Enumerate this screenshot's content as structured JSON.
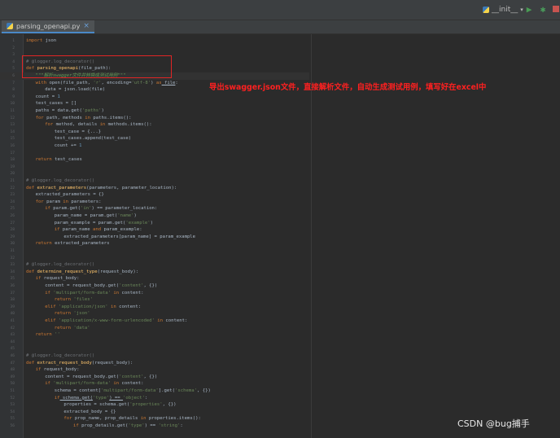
{
  "toolbar": {
    "run_config_label": "__init__",
    "icons": [
      "python-file-icon",
      "chevron-down-icon",
      "run-icon",
      "debug-icon",
      "stop-icon"
    ],
    "colors": {
      "run": "#499c54",
      "debug": "#4a9e5c",
      "stop": "#c75450"
    }
  },
  "tab": {
    "file_name": "parsing_openapi.py",
    "close_glyph": "×"
  },
  "annotation": "导出swagger.json文件，直接解析文件，自动生成测试用例，填写好在excel中",
  "watermark": "CSDN @bug捕手",
  "colors": {
    "annotation": "#ff2020",
    "highlight_box": "#e02525",
    "editor_bg": "#2b2b2b"
  },
  "code_lines": [
    {
      "n": "1",
      "indent": 0,
      "parts": [
        {
          "t": "kw",
          "v": "import"
        },
        {
          "t": "",
          "v": " json"
        }
      ]
    },
    {
      "n": "2",
      "indent": 0,
      "parts": []
    },
    {
      "n": "3",
      "indent": 0,
      "parts": []
    },
    {
      "n": "4",
      "indent": 0,
      "parts": [
        {
          "t": "dec",
          "v": "# @logger.log_decorator()"
        }
      ]
    },
    {
      "n": "5",
      "indent": 0,
      "parts": [
        {
          "t": "kw",
          "v": "def"
        },
        {
          "t": "fn",
          "v": " parsing_openapi"
        },
        {
          "t": "",
          "v": "(file_path):"
        }
      ]
    },
    {
      "n": "6",
      "indent": 1,
      "parts": [
        {
          "t": "doc",
          "v": "\"\"\"解析swagger文件并转换成测试用例\"\"\""
        }
      ]
    },
    {
      "n": "7",
      "indent": 1,
      "parts": [
        {
          "t": "kw",
          "v": "with"
        },
        {
          "t": "",
          "v": " open(file_path, "
        },
        {
          "t": "str",
          "v": "'r'"
        },
        {
          "t": "",
          "v": ", encoding="
        },
        {
          "t": "str",
          "v": "'utf-8'"
        },
        {
          "t": "",
          "v": ") "
        },
        {
          "t": "kw",
          "v": "as"
        },
        {
          "t": "und",
          "v": " file"
        },
        {
          "t": "",
          "v": ":"
        }
      ]
    },
    {
      "n": "8",
      "indent": 2,
      "parts": [
        {
          "t": "",
          "v": "data = json.load(file)"
        }
      ]
    },
    {
      "n": "9",
      "indent": 1,
      "parts": [
        {
          "t": "",
          "v": "count = "
        },
        {
          "t": "num",
          "v": "1"
        }
      ]
    },
    {
      "n": "10",
      "indent": 1,
      "parts": [
        {
          "t": "",
          "v": "test_cases = []"
        }
      ]
    },
    {
      "n": "11",
      "indent": 1,
      "parts": [
        {
          "t": "",
          "v": "paths = data.get("
        },
        {
          "t": "str",
          "v": "'paths'"
        },
        {
          "t": "",
          "v": ")"
        }
      ]
    },
    {
      "n": "12",
      "indent": 1,
      "parts": [
        {
          "t": "kw",
          "v": "for"
        },
        {
          "t": "",
          "v": " path, methods "
        },
        {
          "t": "kw",
          "v": "in"
        },
        {
          "t": "",
          "v": " paths.items():"
        }
      ]
    },
    {
      "n": "13",
      "indent": 2,
      "parts": [
        {
          "t": "kw",
          "v": "for"
        },
        {
          "t": "",
          "v": " method, details "
        },
        {
          "t": "kw",
          "v": "in"
        },
        {
          "t": "",
          "v": " methods.items():"
        }
      ]
    },
    {
      "n": "14",
      "indent": 3,
      "parts": [
        {
          "t": "",
          "v": "test_case = {...}"
        }
      ]
    },
    {
      "n": "15",
      "indent": 3,
      "parts": [
        {
          "t": "",
          "v": "test_cases.append(test_case)"
        }
      ]
    },
    {
      "n": "16",
      "indent": 3,
      "parts": [
        {
          "t": "",
          "v": "count += "
        },
        {
          "t": "num",
          "v": "1"
        }
      ]
    },
    {
      "n": "17",
      "indent": 0,
      "parts": []
    },
    {
      "n": "18",
      "indent": 1,
      "parts": [
        {
          "t": "kw",
          "v": "return"
        },
        {
          "t": "",
          "v": " test_cases"
        }
      ]
    },
    {
      "n": "19",
      "indent": 0,
      "parts": []
    },
    {
      "n": "20",
      "indent": 0,
      "parts": []
    },
    {
      "n": "21",
      "indent": 0,
      "parts": [
        {
          "t": "dec",
          "v": "# @logger.log_decorator()"
        }
      ]
    },
    {
      "n": "22",
      "indent": 0,
      "parts": [
        {
          "t": "kw",
          "v": "def"
        },
        {
          "t": "fn",
          "v": " extract_parameters"
        },
        {
          "t": "",
          "v": "(parameters, parameter_location):"
        }
      ]
    },
    {
      "n": "23",
      "indent": 1,
      "parts": [
        {
          "t": "",
          "v": "extracted_parameters = {}"
        }
      ]
    },
    {
      "n": "24",
      "indent": 1,
      "parts": [
        {
          "t": "kw",
          "v": "for"
        },
        {
          "t": "",
          "v": " param "
        },
        {
          "t": "kw",
          "v": "in"
        },
        {
          "t": "",
          "v": " parameters:"
        }
      ]
    },
    {
      "n": "25",
      "indent": 2,
      "parts": [
        {
          "t": "kw",
          "v": "if"
        },
        {
          "t": "",
          "v": " param.get("
        },
        {
          "t": "str",
          "v": "'in'"
        },
        {
          "t": "",
          "v": ") == parameter_location:"
        }
      ]
    },
    {
      "n": "26",
      "indent": 3,
      "parts": [
        {
          "t": "",
          "v": "param_name = param.get("
        },
        {
          "t": "str",
          "v": "'name'"
        },
        {
          "t": "",
          "v": ")"
        }
      ]
    },
    {
      "n": "27",
      "indent": 3,
      "parts": [
        {
          "t": "",
          "v": "param_example = param.get("
        },
        {
          "t": "str",
          "v": "'example'"
        },
        {
          "t": "",
          "v": ")"
        }
      ]
    },
    {
      "n": "28",
      "indent": 3,
      "parts": [
        {
          "t": "kw",
          "v": "if"
        },
        {
          "t": "",
          "v": " param_name "
        },
        {
          "t": "kw",
          "v": "and"
        },
        {
          "t": "",
          "v": " param_example:"
        }
      ]
    },
    {
      "n": "29",
      "indent": 4,
      "parts": [
        {
          "t": "",
          "v": "extracted_parameters[param_name] = param_example"
        }
      ]
    },
    {
      "n": "30",
      "indent": 1,
      "parts": [
        {
          "t": "kw",
          "v": "return"
        },
        {
          "t": "",
          "v": " extracted_parameters"
        }
      ]
    },
    {
      "n": "31",
      "indent": 0,
      "parts": []
    },
    {
      "n": "32",
      "indent": 0,
      "parts": []
    },
    {
      "n": "33",
      "indent": 0,
      "parts": [
        {
          "t": "dec",
          "v": "# @logger.log_decorator()"
        }
      ]
    },
    {
      "n": "34",
      "indent": 0,
      "parts": [
        {
          "t": "kw",
          "v": "def"
        },
        {
          "t": "fn",
          "v": " determine_request_type"
        },
        {
          "t": "",
          "v": "(request_body):"
        }
      ]
    },
    {
      "n": "35",
      "indent": 1,
      "parts": [
        {
          "t": "kw",
          "v": "if"
        },
        {
          "t": "",
          "v": " request_body:"
        }
      ]
    },
    {
      "n": "36",
      "indent": 2,
      "parts": [
        {
          "t": "",
          "v": "content = request_body.get("
        },
        {
          "t": "str",
          "v": "'content'"
        },
        {
          "t": "",
          "v": ", {})"
        }
      ]
    },
    {
      "n": "37",
      "indent": 2,
      "parts": [
        {
          "t": "kw",
          "v": "if"
        },
        {
          "t": "str",
          "v": " 'multipart/form-data'"
        },
        {
          "t": "kw",
          "v": " in"
        },
        {
          "t": "",
          "v": " content:"
        }
      ]
    },
    {
      "n": "38",
      "indent": 3,
      "parts": [
        {
          "t": "kw",
          "v": "return"
        },
        {
          "t": "str",
          "v": " 'files'"
        }
      ]
    },
    {
      "n": "39",
      "indent": 2,
      "parts": [
        {
          "t": "kw",
          "v": "elif"
        },
        {
          "t": "str",
          "v": " 'application/json'"
        },
        {
          "t": "kw",
          "v": " in"
        },
        {
          "t": "",
          "v": " content:"
        }
      ]
    },
    {
      "n": "40",
      "indent": 3,
      "parts": [
        {
          "t": "kw",
          "v": "return"
        },
        {
          "t": "str",
          "v": " 'json'"
        }
      ]
    },
    {
      "n": "41",
      "indent": 2,
      "parts": [
        {
          "t": "kw",
          "v": "elif"
        },
        {
          "t": "str",
          "v": " 'application/x-www-form-urlencoded'"
        },
        {
          "t": "kw",
          "v": " in"
        },
        {
          "t": "",
          "v": " content:"
        }
      ]
    },
    {
      "n": "42",
      "indent": 3,
      "parts": [
        {
          "t": "kw",
          "v": "return"
        },
        {
          "t": "str",
          "v": " 'data'"
        }
      ]
    },
    {
      "n": "43",
      "indent": 1,
      "parts": [
        {
          "t": "kw",
          "v": "return"
        },
        {
          "t": "str",
          "v": " ''"
        }
      ]
    },
    {
      "n": "44",
      "indent": 0,
      "parts": []
    },
    {
      "n": "45",
      "indent": 0,
      "parts": []
    },
    {
      "n": "46",
      "indent": 0,
      "parts": [
        {
          "t": "dec",
          "v": "# @logger.log_decorator()"
        }
      ]
    },
    {
      "n": "47",
      "indent": 0,
      "parts": [
        {
          "t": "kw",
          "v": "def"
        },
        {
          "t": "fn",
          "v": " extract_request_body"
        },
        {
          "t": "",
          "v": "(request_body):"
        }
      ]
    },
    {
      "n": "48",
      "indent": 1,
      "parts": [
        {
          "t": "kw",
          "v": "if"
        },
        {
          "t": "",
          "v": " request_body:"
        }
      ]
    },
    {
      "n": "49",
      "indent": 2,
      "parts": [
        {
          "t": "",
          "v": "content = request_body.get("
        },
        {
          "t": "str",
          "v": "'content'"
        },
        {
          "t": "",
          "v": ", {})"
        }
      ]
    },
    {
      "n": "50",
      "indent": 2,
      "parts": [
        {
          "t": "kw",
          "v": "if"
        },
        {
          "t": "str",
          "v": " 'multipart/form-data'"
        },
        {
          "t": "kw",
          "v": " in"
        },
        {
          "t": "",
          "v": " content:"
        }
      ]
    },
    {
      "n": "51",
      "indent": 3,
      "parts": [
        {
          "t": "",
          "v": "schema = content["
        },
        {
          "t": "str",
          "v": "'multipart/form-data'"
        },
        {
          "t": "",
          "v": "].get("
        },
        {
          "t": "str",
          "v": "'schema'"
        },
        {
          "t": "",
          "v": ", {})"
        }
      ]
    },
    {
      "n": "52",
      "indent": 3,
      "parts": [
        {
          "t": "kw",
          "v": "if"
        },
        {
          "t": "und",
          "v": " schema.get("
        },
        {
          "t": "str",
          "v": "'type'"
        },
        {
          "t": "und",
          "v": ") == "
        },
        {
          "t": "str",
          "v": "'object'"
        },
        {
          "t": "",
          "v": ":"
        }
      ]
    },
    {
      "n": "53",
      "indent": 4,
      "parts": [
        {
          "t": "",
          "v": "properties = schema.get("
        },
        {
          "t": "str",
          "v": "'properties'"
        },
        {
          "t": "",
          "v": ", {})"
        }
      ]
    },
    {
      "n": "54",
      "indent": 4,
      "parts": [
        {
          "t": "",
          "v": "extracted_body = {}"
        }
      ]
    },
    {
      "n": "55",
      "indent": 4,
      "parts": [
        {
          "t": "kw",
          "v": "for"
        },
        {
          "t": "",
          "v": " prop_name, prop_details "
        },
        {
          "t": "kw",
          "v": "in"
        },
        {
          "t": "",
          "v": " properties.items():"
        }
      ]
    },
    {
      "n": "56",
      "indent": 5,
      "parts": [
        {
          "t": "kw",
          "v": "if"
        },
        {
          "t": "",
          "v": " prop_details.get("
        },
        {
          "t": "str",
          "v": "'type'"
        },
        {
          "t": "",
          "v": ") == "
        },
        {
          "t": "str",
          "v": "'string'"
        },
        {
          "t": "",
          "v": ":"
        }
      ]
    }
  ]
}
